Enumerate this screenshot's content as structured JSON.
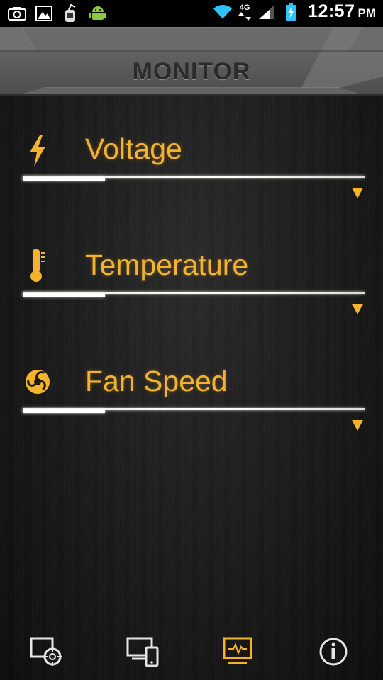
{
  "status_bar": {
    "left_icons": [
      "camera-icon",
      "gallery-icon",
      "debug-icon",
      "android-icon"
    ],
    "right_icons": [
      "wifi-icon",
      "network-4g-icon",
      "signal-icon",
      "battery-charging-icon"
    ],
    "network_label": "4G",
    "time": "12:57",
    "ampm": "PM"
  },
  "header": {
    "title": "MONITOR"
  },
  "sections": [
    {
      "label": "Voltage",
      "icon": "lightning-icon",
      "progress": 0.24
    },
    {
      "label": "Temperature",
      "icon": "thermometer-icon",
      "progress": 0.24
    },
    {
      "label": "Fan Speed",
      "icon": "fan-icon",
      "progress": 0.24
    }
  ],
  "bottom_nav": {
    "items": [
      {
        "icon": "target-screen-icon",
        "active": false
      },
      {
        "icon": "devices-icon",
        "active": false
      },
      {
        "icon": "monitor-pulse-icon",
        "active": true
      },
      {
        "icon": "info-icon",
        "active": false
      }
    ]
  },
  "colors": {
    "accent": "#f5b32d",
    "header_text": "#2b2b2b",
    "nav_icon": "#e6e6e6",
    "background": "#1a1a1a"
  }
}
